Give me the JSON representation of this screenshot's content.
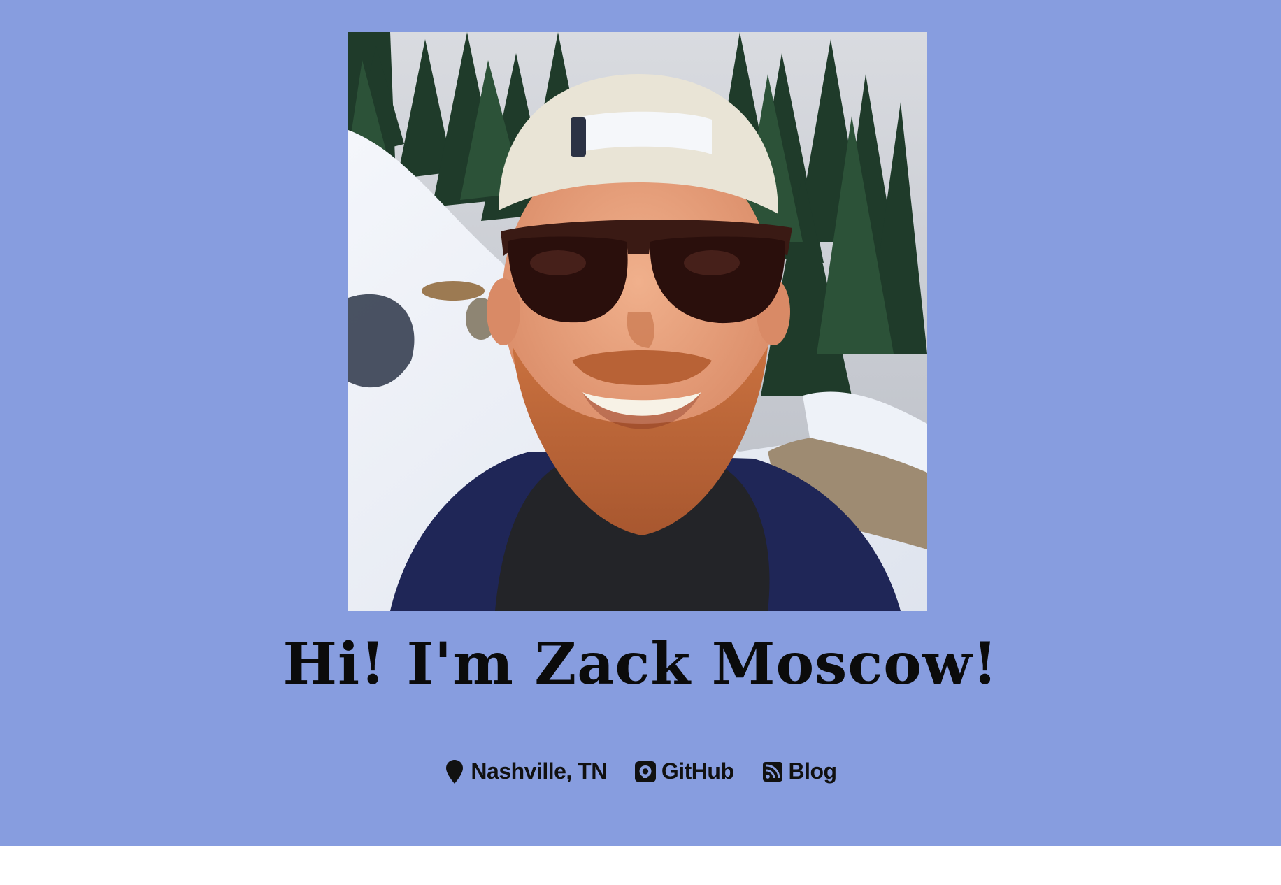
{
  "profile": {
    "photo_alt": "Zack Moscow",
    "headline": "Hi! I'm Zack Moscow!"
  },
  "links": {
    "location": {
      "label": "Nashville, TN",
      "icon": "map-marker-icon"
    },
    "github": {
      "label": "GitHub",
      "icon": "github-icon"
    },
    "blog": {
      "label": "Blog",
      "icon": "rss-icon"
    }
  },
  "colors": {
    "background": "#879ddf",
    "text": "#0b0b0b",
    "page": "#ffffff"
  }
}
